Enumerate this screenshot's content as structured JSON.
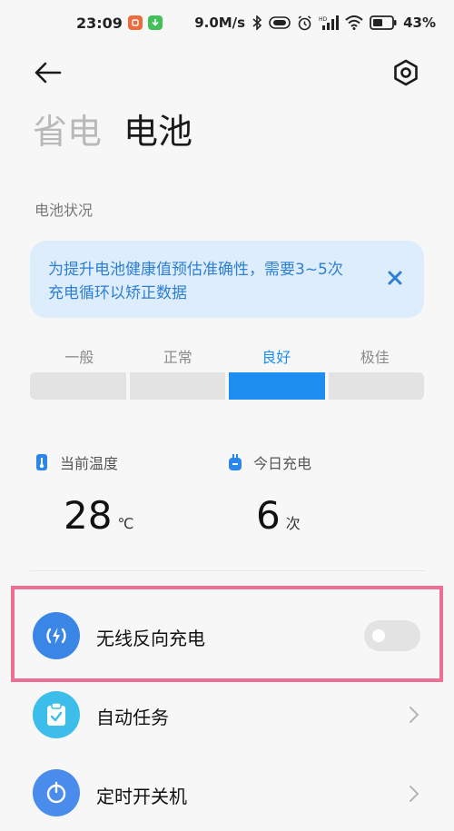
{
  "status_bar": {
    "time": "23:09",
    "network_speed": "9.0M/s",
    "battery_percent": "43%",
    "notification_icons": [
      "mi-app-icon",
      "download-icon"
    ],
    "system_icons": [
      "bluetooth-icon",
      "toggle-icon",
      "alarm-icon",
      "signal-icon",
      "wifi-icon",
      "battery-icon"
    ]
  },
  "header": {
    "back_icon": "arrow-left-icon",
    "settings_icon": "hexagon-settings-icon",
    "tabs": [
      {
        "label": "省电",
        "active": false
      },
      {
        "label": "电池",
        "active": true
      }
    ]
  },
  "battery_status": {
    "section_label": "电池状况",
    "tip": {
      "line1": "为提升电池健康值预估准确性，需要3~5次",
      "line2": "充电循环以矫正数据",
      "close_icon": "close-icon"
    },
    "health_levels": [
      "一般",
      "正常",
      "良好",
      "极佳"
    ],
    "current_level": "良好"
  },
  "stats": {
    "temperature": {
      "label": "当前温度",
      "value": "28",
      "unit": "℃",
      "icon": "thermometer-icon"
    },
    "charges_today": {
      "label": "今日充电",
      "value": "6",
      "unit": "次",
      "icon": "battery-small-icon"
    }
  },
  "list": [
    {
      "label": "无线反向充电",
      "icon": "wireless-charge-icon",
      "control": "toggle",
      "enabled": false,
      "highlighted": true
    },
    {
      "label": "自动任务",
      "icon": "clipboard-check-icon",
      "control": "chevron"
    },
    {
      "label": "定时开关机",
      "icon": "power-clock-icon",
      "control": "chevron"
    }
  ],
  "colors": {
    "accent": "#1e8ff0",
    "tip_background": "#deedfb",
    "tip_text": "#2d7fd3",
    "highlight_border": "#ee6e94",
    "wireless_icon_bg": "#3a86e6",
    "task_icon_bg": "#3dbdea",
    "power_icon_bg": "#4a8cec"
  }
}
